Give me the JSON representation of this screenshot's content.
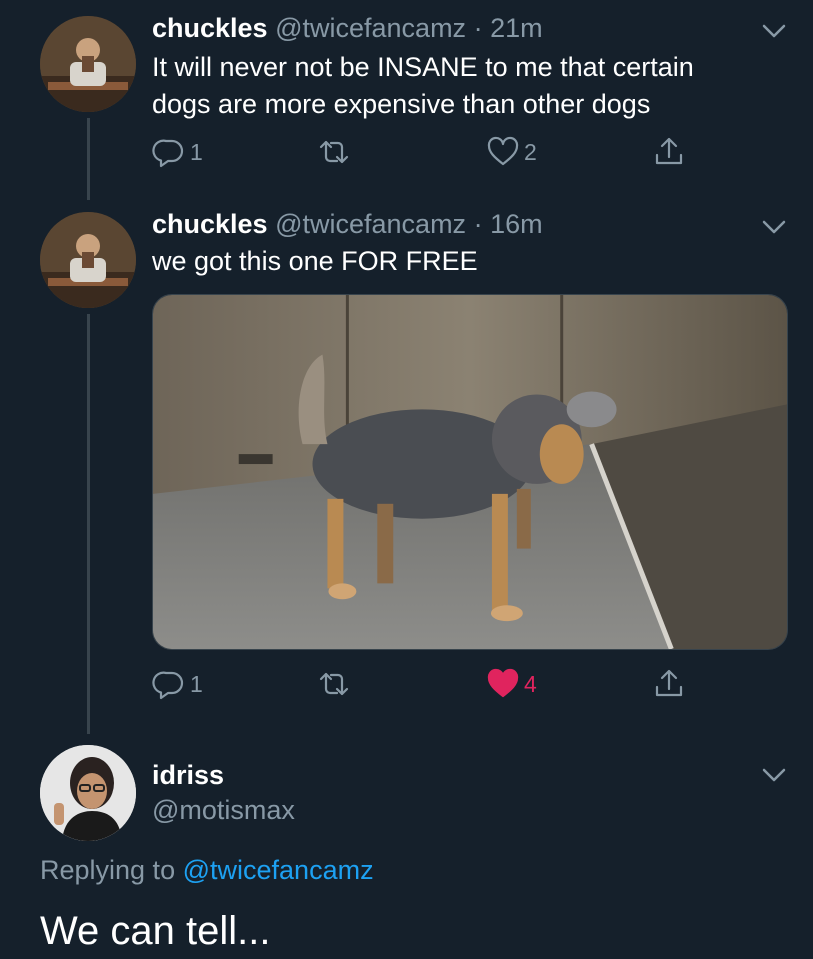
{
  "tweets": [
    {
      "name": "chuckles",
      "handle": "@twicefancamz",
      "separator": "·",
      "time": "21m",
      "text_line1": "It will never not be INSANE to me that certain",
      "text_line2": "dogs are more expensive than other dogs",
      "replies": "1",
      "retweets": "",
      "likes": "2"
    },
    {
      "name": "chuckles",
      "handle": "@twicefancamz",
      "separator": "·",
      "time": "16m",
      "text_line1": "we got this one FOR FREE",
      "replies": "1",
      "retweets": "",
      "likes": "4",
      "liked": true
    }
  ],
  "reply": {
    "name": "idriss",
    "handle": "@motismax",
    "replying_prefix": "Replying to",
    "replying_to": "@twicefancamz",
    "text": "We can tell..."
  },
  "colors": {
    "background": "#15202b",
    "secondary_text": "#8899a6",
    "link": "#1da1f2",
    "like_active": "#e0245e"
  },
  "icons": [
    "reply-icon",
    "retweet-icon",
    "heart-icon",
    "share-icon",
    "chevron-down-icon"
  ]
}
